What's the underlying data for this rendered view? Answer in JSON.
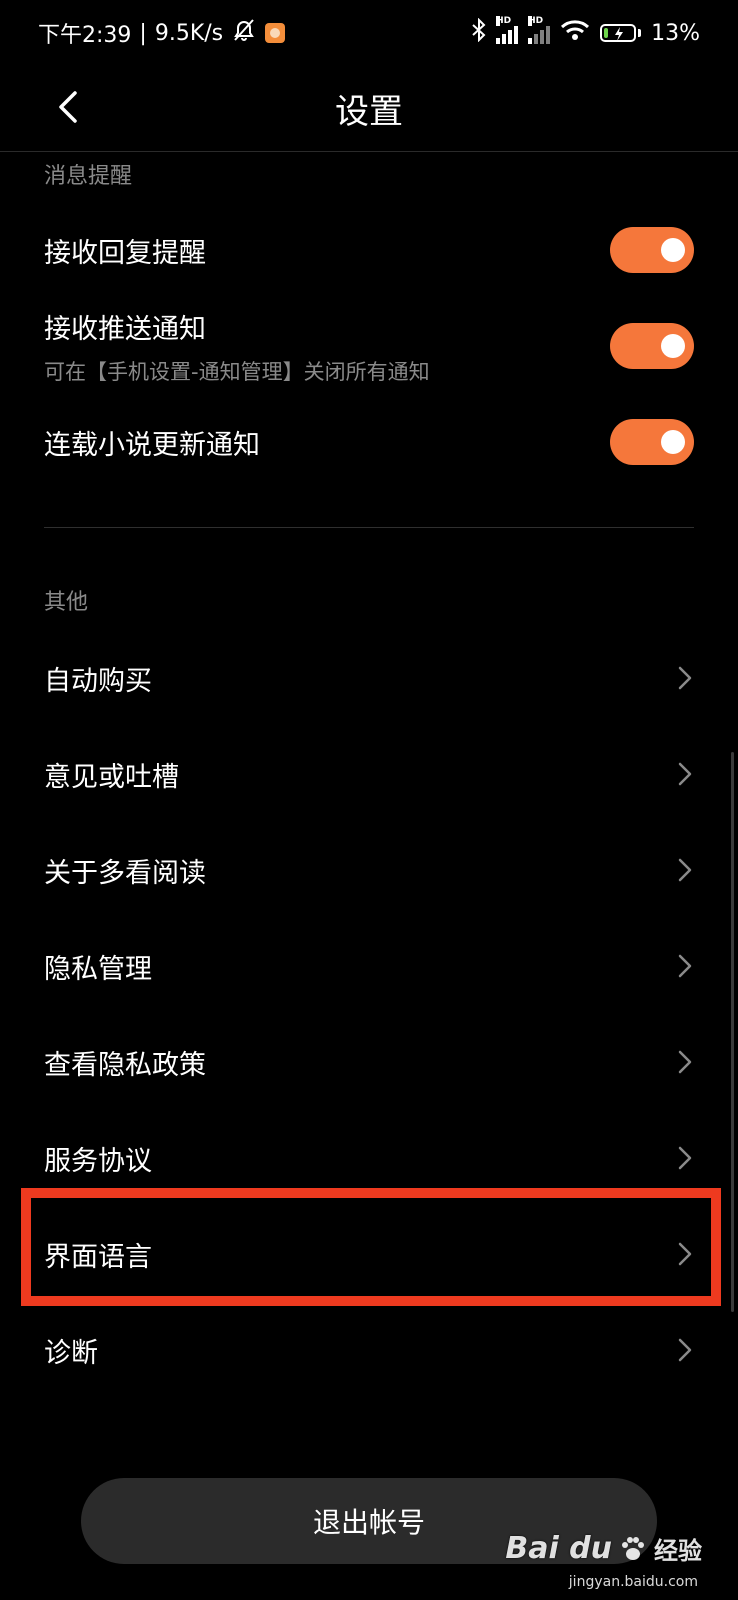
{
  "status": {
    "time": "下午2:39",
    "separator": "|",
    "net_speed": "9.5K/s",
    "battery": "13%",
    "battery_level": 0.13,
    "signal_label": "HD"
  },
  "nav": {
    "title": "设置"
  },
  "sections": {
    "notify": {
      "label": "消息提醒",
      "items": [
        {
          "label": "接收回复提醒",
          "enabled": true
        },
        {
          "label": "接收推送通知",
          "sub": "可在【手机设置-通知管理】关闭所有通知",
          "enabled": true
        },
        {
          "label": "连载小说更新通知",
          "enabled": true
        }
      ]
    },
    "other": {
      "label": "其他",
      "items": [
        {
          "label": "自动购买"
        },
        {
          "label": "意见或吐槽"
        },
        {
          "label": "关于多看阅读"
        },
        {
          "label": "隐私管理"
        },
        {
          "label": "查看隐私政策"
        },
        {
          "label": "服务协议"
        },
        {
          "label": "界面语言"
        },
        {
          "label": "诊断"
        }
      ]
    }
  },
  "logout": {
    "label": "退出帐号"
  },
  "watermark": {
    "brand": "Bai du",
    "text": "经验",
    "url": "jingyan.baidu.com"
  },
  "colors": {
    "toggle_on": "#f5773b",
    "highlight": "#ee3a1f",
    "background": "#000000"
  }
}
